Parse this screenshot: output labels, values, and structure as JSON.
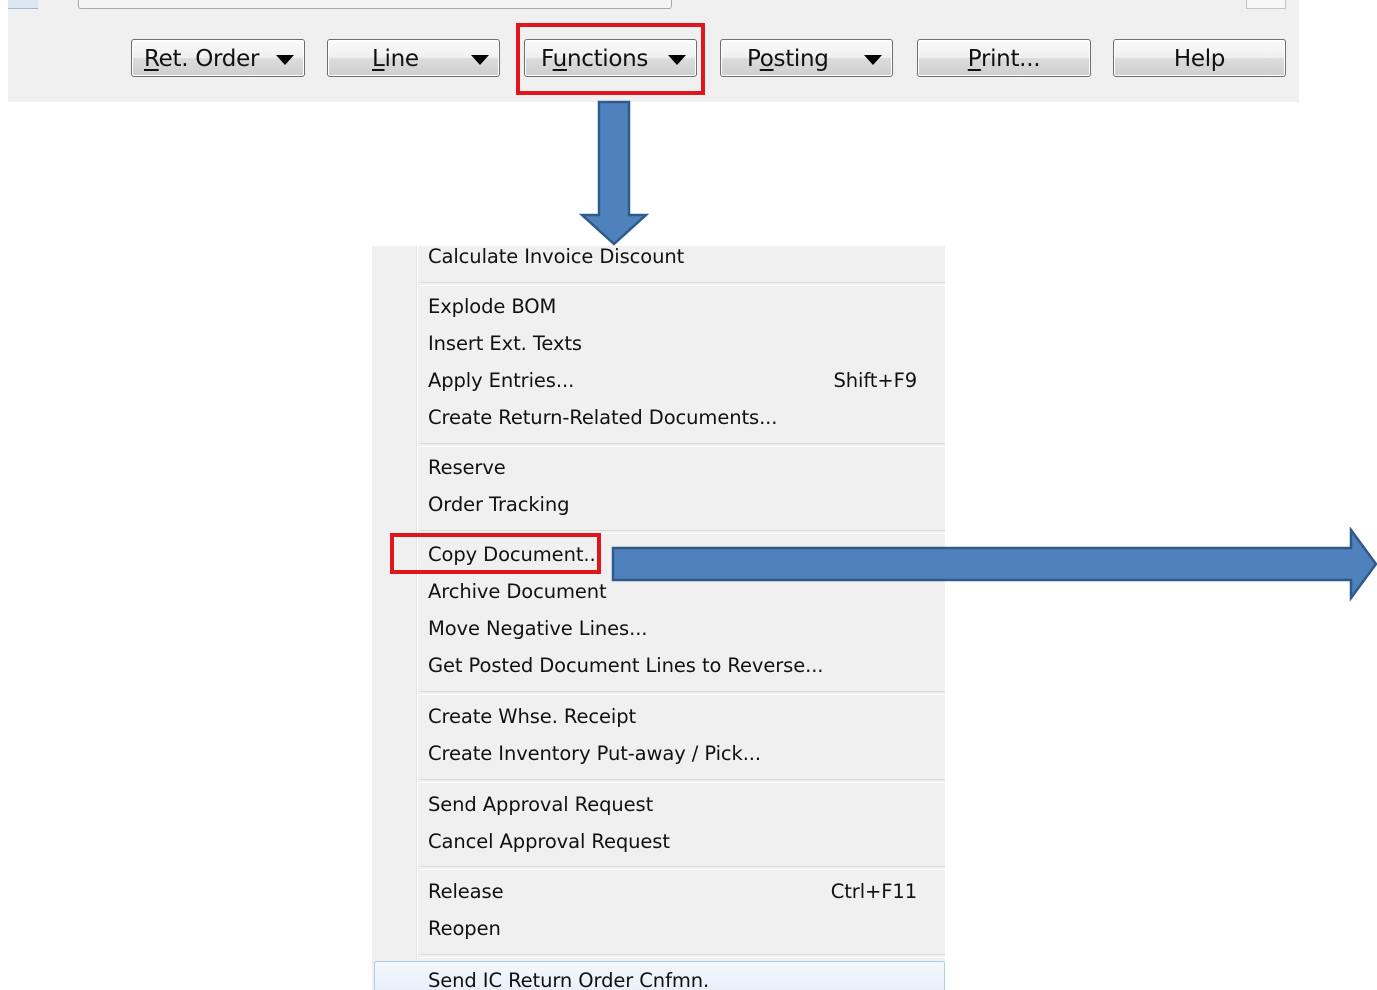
{
  "toolbar": {
    "buttons": [
      {
        "label_pre": "",
        "label_u": "R",
        "label_post": "et. Order",
        "dropdown": true
      },
      {
        "label_pre": "",
        "label_u": "L",
        "label_post": "ine",
        "dropdown": true
      },
      {
        "label_pre": "F",
        "label_u": "u",
        "label_post": "nctions",
        "dropdown": true
      },
      {
        "label_pre": "P",
        "label_u": "o",
        "label_post": "sting",
        "dropdown": true
      },
      {
        "label_pre": "",
        "label_u": "P",
        "label_post": "rint...",
        "dropdown": false
      },
      {
        "label_pre": "",
        "label_u": "",
        "label_post": "Help",
        "dropdown": false
      }
    ]
  },
  "menu": {
    "items": [
      {
        "label": "Calculate Invoice Discount",
        "shortcut": ""
      },
      {
        "label": "Explode BOM",
        "shortcut": ""
      },
      {
        "label": "Insert Ext. Texts",
        "shortcut": ""
      },
      {
        "label": "Apply Entries...",
        "shortcut": "Shift+F9"
      },
      {
        "label": "Create Return-Related Documents...",
        "shortcut": ""
      },
      {
        "label": "Reserve",
        "shortcut": ""
      },
      {
        "label": "Order Tracking",
        "shortcut": ""
      },
      {
        "label": "Copy Document...",
        "shortcut": ""
      },
      {
        "label": "Archive Document",
        "shortcut": ""
      },
      {
        "label": "Move Negative Lines...",
        "shortcut": ""
      },
      {
        "label": "Get Posted Document Lines to Reverse...",
        "shortcut": ""
      },
      {
        "label": "Create Whse. Receipt",
        "shortcut": ""
      },
      {
        "label": "Create Inventory Put-away / Pick...",
        "shortcut": ""
      },
      {
        "label": "Send Approval Request",
        "shortcut": ""
      },
      {
        "label": "Cancel Approval Request",
        "shortcut": ""
      },
      {
        "label": "Release",
        "shortcut": "Ctrl+F11"
      },
      {
        "label": "Reopen",
        "shortcut": ""
      },
      {
        "label": "Send IC Return Order Cnfmn.",
        "shortcut": ""
      }
    ]
  },
  "colors": {
    "highlight": "#e0161e",
    "arrow_fill": "#4f81bd",
    "arrow_stroke": "#2f5a8c"
  }
}
